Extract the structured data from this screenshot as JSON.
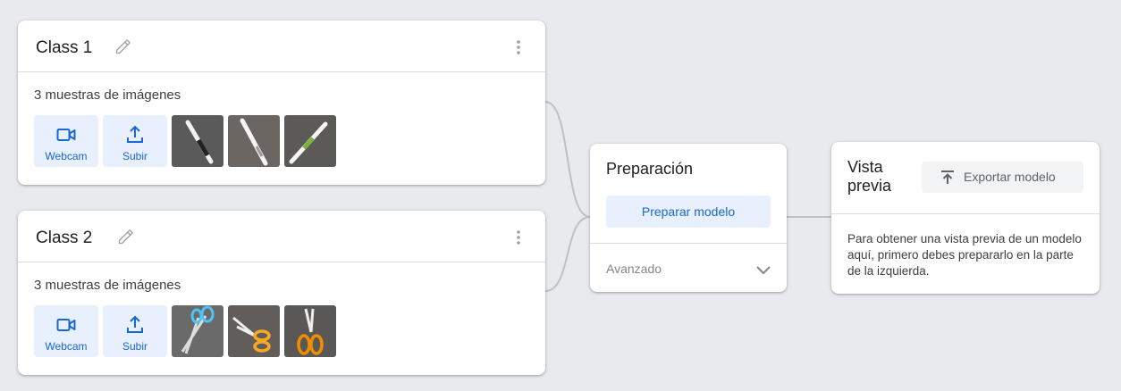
{
  "classes": [
    {
      "title": "Class 1",
      "sample_count_text": "3 muestras de imágenes",
      "webcam_label": "Webcam",
      "upload_label": "Subir",
      "thumbnails": [
        "pen-image",
        "pen-image",
        "pen-image"
      ]
    },
    {
      "title": "Class 2",
      "sample_count_text": "3 muestras de imágenes",
      "webcam_label": "Webcam",
      "upload_label": "Subir",
      "thumbnails": [
        "scissors-image",
        "scissors-image",
        "scissors-image"
      ]
    }
  ],
  "training": {
    "title": "Preparación",
    "train_button": "Preparar modelo",
    "advanced_label": "Avanzado"
  },
  "preview": {
    "title": "Vista previa",
    "export_button": "Exportar modelo",
    "message": "Para obtener una vista previa de un modelo aquí, primero debes prepararlo en la parte de la izquierda."
  },
  "colors": {
    "background": "#e8eaed",
    "accent_blue": "#1967d2",
    "button_blue_bg": "#e8f0fe",
    "connector": "#bdc1c6"
  }
}
